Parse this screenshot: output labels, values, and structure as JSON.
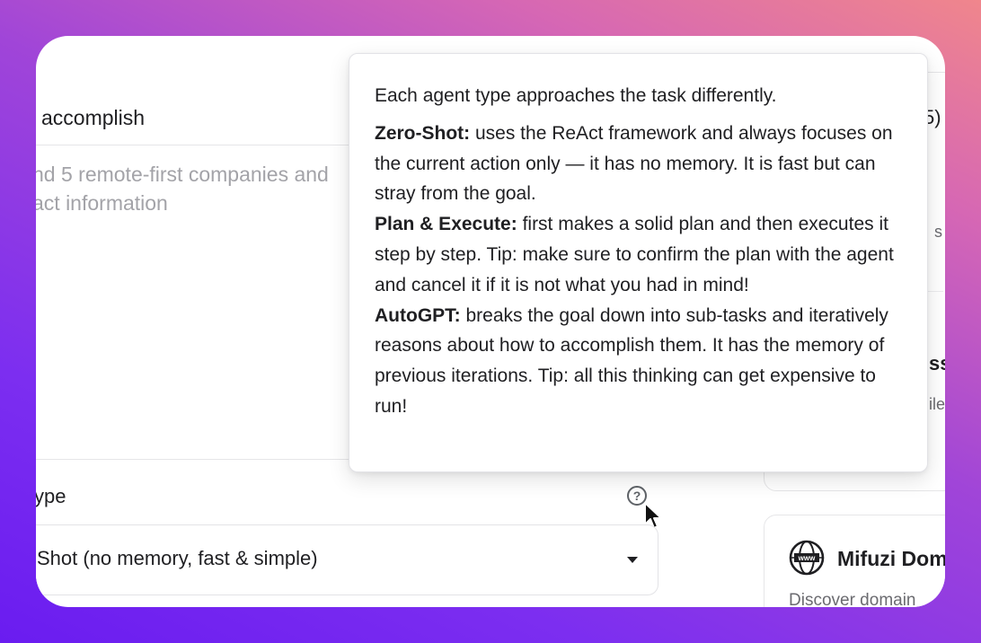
{
  "form": {
    "goal_label": "accomplish",
    "goal_placeholder": "nd 5 remote-first companies and",
    "goal_placeholder_line2": "act information",
    "agent_type_label": "ype",
    "agent_type_value": "Shot (no memory, fast & simple)",
    "help_icon": "question-circle-icon"
  },
  "tooltip": {
    "intro": "Each agent type approaches the task differently.",
    "items": [
      {
        "name": "Zero-Shot:",
        "text": " uses the ReAct framework and always focuses on the current action only — it has no memory. It is fast but can stray from the goal."
      },
      {
        "name": "Plan & Execute:",
        "text": " first makes a solid plan and then executes it step by step. Tip: make sure to confirm the plan with the agent and cancel it if it is not what you had in mind!"
      },
      {
        "name": "AutoGPT:",
        "text": " breaks the goal down into sub-tasks and iteratively reasons about how to accomplish them. It has the memory of previous iterations. Tip: all this thinking can get expensive to run!"
      }
    ]
  },
  "side": {
    "card1_paren": "5)",
    "card1_frag_a": "s",
    "card1_frag_b": "ss",
    "card1_frag_c": "ile",
    "card2_title": "Mifuzi Dom",
    "card2_desc": "Discover domain",
    "card2_icon": "globe-www-icon"
  },
  "colors": {
    "text": "#1f1f22",
    "placeholder": "#a3a3a8",
    "border": "#e3e3e6"
  }
}
